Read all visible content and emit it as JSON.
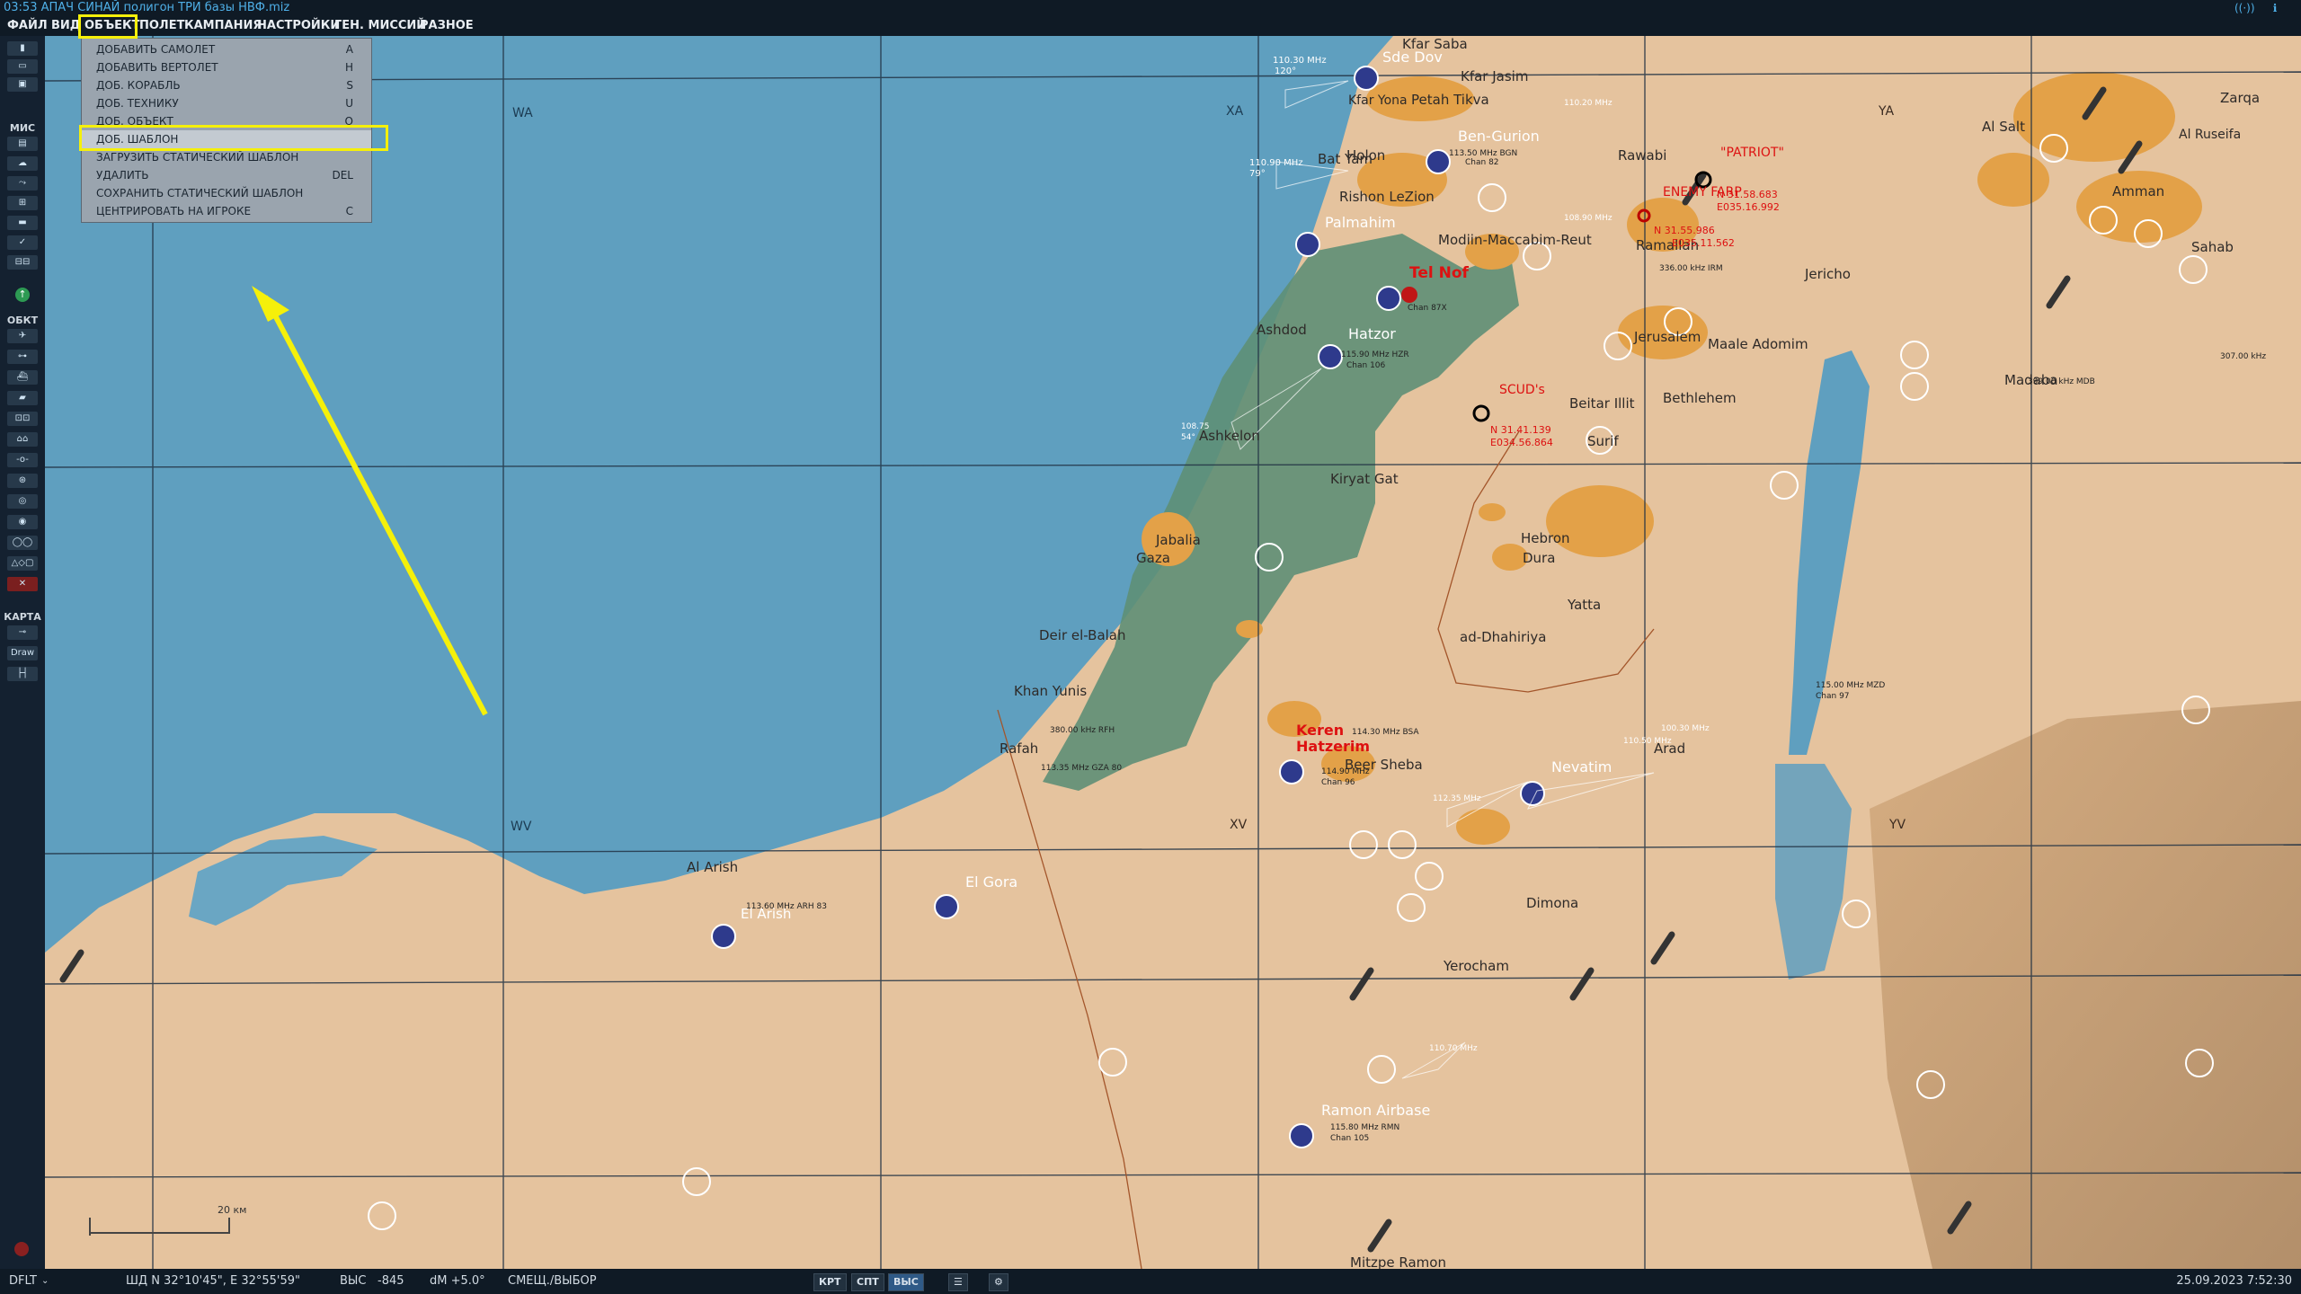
{
  "window": {
    "title": "03:53  АПАЧ СИНАЙ полигон ТРИ  базы НВФ.miz"
  },
  "menu": [
    {
      "label": "ФАЙЛ"
    },
    {
      "label": "ВИД"
    },
    {
      "label": "ОБЪЕКТ"
    },
    {
      "label": "ПОЛЕТ"
    },
    {
      "label": "КАМПАНИЯ"
    },
    {
      "label": "НАСТРОЙКИ"
    },
    {
      "label": "ГЕН. МИССИЙ"
    },
    {
      "label": "РАЗНОЕ"
    }
  ],
  "dropdown": {
    "items": [
      {
        "label": "ДОБАВИТЬ САМОЛЕТ",
        "key": "A"
      },
      {
        "label": "ДОБАВИТЬ ВЕРТОЛЕТ",
        "key": "H"
      },
      {
        "label": "ДОБ. КОРАБЛЬ",
        "key": "S"
      },
      {
        "label": "ДОБ. ТЕХНИКУ",
        "key": "U"
      },
      {
        "label": "ДОБ. ОБЪЕКТ",
        "key": "O"
      },
      {
        "label": "ДОБ. ШАБЛОН",
        "key": ""
      },
      {
        "label": "ЗАГРУЗИТЬ СТАТИЧЕСКИЙ ШАБЛОН",
        "key": ""
      },
      {
        "label": "УДАЛИТЬ",
        "key": "DEL"
      },
      {
        "label": "СОХРАНИТЬ СТАТИЧЕСКИЙ ШАБЛОН",
        "key": ""
      },
      {
        "label": "ЦЕНТРИРОВАТЬ НА ИГРОКЕ",
        "key": "C"
      }
    ],
    "selected_index": 5
  },
  "sidebar": {
    "groups": [
      "МИС",
      "ОБКТ",
      "КАРТА"
    ],
    "draw_label": "Draw"
  },
  "map": {
    "grid_labels": [
      "WA",
      "XA",
      "YA",
      "WV",
      "XV",
      "YV"
    ],
    "cities": [
      "Kfar Saba",
      "Sde Dov",
      "Kfar Yona",
      "Petah Tikva",
      "Kfar Jasim",
      "Ben-Gurion",
      "Bat Yam",
      "Holon",
      "Rishon LeZion",
      "Palmahim",
      "Modiin-Maccabim-Reut",
      "Rawabi",
      "Ramallah",
      "Jericho",
      "Al Salt",
      "Zarqa",
      "Amman",
      "Sahab",
      "Madaba",
      "Tel Nof",
      "Hatzor",
      "Ashdod",
      "Jerusalem",
      "Maale Adomim",
      "Bethlehem",
      "Beitar Illit",
      "Surif",
      "Ashkelon",
      "Kiryat Gat",
      "Jabalia",
      "Gaza",
      "Hebron",
      "Dura",
      "Yatta",
      "ad-Dhahiriya",
      "Deir el-Balah",
      "Khan Yunis",
      "Rafah",
      "Keren Hatzerim",
      "Beer Sheba",
      "Nevatim",
      "Arad",
      "Al Arish",
      "El Arish",
      "El Gora",
      "Dimona",
      "Yerocham",
      "Ramon Airbase",
      "Mitzpe Ramon",
      "Al Ruseifa"
    ],
    "red_labels": [
      "\"PATRIOT\"",
      "ENEMY FARP",
      "SCUD's",
      "Tel Nof",
      "Keren",
      "Hatzerim"
    ],
    "red_coords": [
      "N 31.58.683",
      "E035.16.992",
      "N 31.55.986",
      "E035.11.562",
      "N 31.41.139",
      "E034.56.864"
    ],
    "navaids": [
      "110.30 MHz",
      "120°",
      "113.50 MHz BGN",
      "Chan 82",
      "110.90 MHz",
      "79°",
      "Chan 87X",
      "115.90 MHz HZR",
      "Chan 106",
      "336.00 kHz IRM",
      "307.00 kHz",
      "399.00 kHz MDB",
      "380.00 kHz RFH",
      "113.35 MHz GZA 80",
      "114.30 MHz BSA",
      "114.90 MHz",
      "Chan 96",
      "115.00 MHz MZD",
      "Chan 97",
      "113.60 MHz ARH 83",
      "115.80 MHz RMN",
      "Chan 105",
      "112.35 MHz",
      "110.70 MHz",
      "108.75",
      "54°",
      "100.30 MHz",
      "108.90 MHz",
      "110.50 MHz",
      "110.20 MHz"
    ],
    "scale_label": "20 км"
  },
  "status": {
    "mode": "DFLT",
    "coords": "ШД  N 32°10'45\", E 32°55'59\"",
    "alt_label": "ВЫС",
    "alt_value": "-845",
    "dm": "dM  +5.0°",
    "mode_text": "СМЕЩ./ВЫБОР",
    "btn1": "КРТ",
    "btn2": "СПТ",
    "btn3": "ВЫС",
    "datetime": "25.09.2023 7:52:30"
  },
  "colors": {
    "sea": "#5f9fbf",
    "land": "#e5c39e",
    "urban": "#e3a148",
    "red_zone": "#5e8f76",
    "highlight": "#ffff00"
  }
}
